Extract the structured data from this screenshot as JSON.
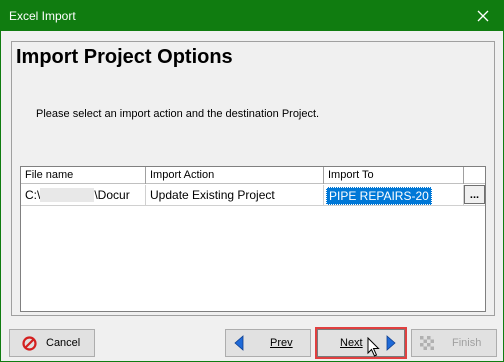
{
  "window": {
    "title": "Excel Import"
  },
  "page": {
    "heading": "Import Project Options",
    "instructions": "Please select an import action and the destination Project."
  },
  "grid": {
    "columns": [
      "File name",
      "Import Action",
      "Import To"
    ],
    "rows": [
      {
        "file_prefix": "C:\\",
        "file_suffix": "\\Docur",
        "action": "Update Existing Project",
        "destination": "PIPE REPAIRS-20",
        "browse": "..."
      }
    ]
  },
  "buttons": {
    "cancel": "Cancel",
    "prev": "Prev",
    "next": "Next",
    "finish": "Finish"
  },
  "colors": {
    "titlebar": "#107c10",
    "selection": "#0078d7",
    "highlight_box": "#e04040"
  }
}
